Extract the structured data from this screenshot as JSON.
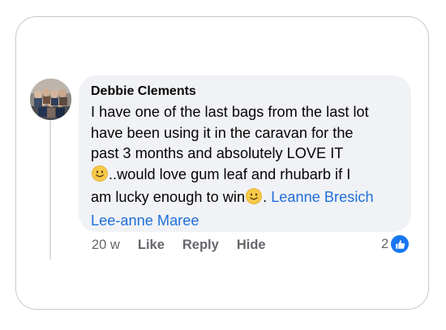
{
  "comment": {
    "author": "Debbie Clements",
    "lines": [
      "I have one of the last bags from the last lot",
      "have been using it in the caravan for the",
      "past 3 months and absolutely LOVE IT",
      "..would love gum leaf and rhubarb if I",
      "am lucky enough to win",
      ". ",
      "Leanne Bresich",
      "Lee-anne Maree"
    ],
    "emoji": "slightly-smiling-face",
    "mentions": [
      "Leanne Bresich",
      "Lee-anne Maree"
    ]
  },
  "actions": {
    "time": "20 w",
    "like": "Like",
    "reply": "Reply",
    "hide": "Hide"
  },
  "reactions": {
    "count": "2",
    "type": "like-icon"
  },
  "colors": {
    "bubble": "#f0f2f5",
    "mention": "#216fdb",
    "meta": "#65676b",
    "like_badge": "#1877f2"
  }
}
